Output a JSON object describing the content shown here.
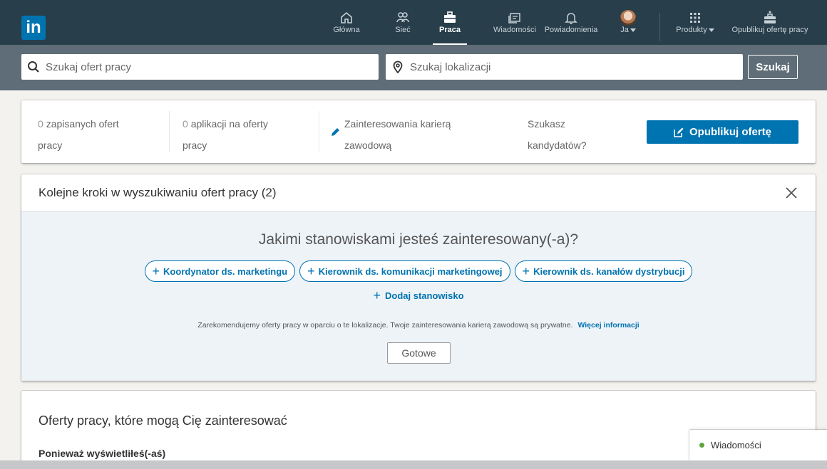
{
  "colors": {
    "nav_bg": "#283e4a",
    "search_band": "#5e6d77",
    "brand_blue": "#0073b1",
    "online_green": "#5fa53d"
  },
  "nav": {
    "logo": "in",
    "items": [
      {
        "label": "Główna",
        "icon": "home-icon"
      },
      {
        "label": "Sieć",
        "icon": "network-icon"
      },
      {
        "label": "Praca",
        "icon": "briefcase-icon",
        "active": true
      },
      {
        "label": "Wiadomości",
        "icon": "messaging-icon"
      },
      {
        "label": "Powiadomienia",
        "icon": "bell-icon"
      },
      {
        "label": "Ja",
        "icon": "avatar"
      },
      {
        "label": "Produkty",
        "icon": "grid-icon"
      },
      {
        "label": "Opublikuj ofertę pracy",
        "icon": "post-job-icon"
      }
    ]
  },
  "search": {
    "jobs_placeholder": "Szukaj ofert pracy",
    "location_placeholder": "Szukaj lokalizacji",
    "button": "Szukaj"
  },
  "stats": {
    "saved_count": "0",
    "saved_label_1": "zapisanych ofert",
    "saved_label_2": "pracy",
    "applications_count": "0",
    "applications_label_1": "aplikacji na oferty",
    "applications_label_2": "pracy",
    "interests_1": "Zainteresowania karierą",
    "interests_2": "zawodową",
    "candidates_1": "Szukasz",
    "candidates_2": "kandydatów?",
    "post_button": "Opublikuj ofertę"
  },
  "next_steps": {
    "title": "Kolejne kroki w wyszukiwaniu ofert pracy (2)",
    "question": "Jakimi stanowiskami jesteś zainteresowany(-a)?",
    "chips": [
      "Koordynator ds. marketingu",
      "Kierownik ds. komunikacji marketingowej",
      "Kierownik ds. kanałów dystrybucji"
    ],
    "add_label": "Dodaj stanowisko",
    "note": "Zarekomendujemy oferty pracy w oparciu o te lokalizacje. Twoje zainteresowania karierą zawodową są prywatne.",
    "note_link": "Więcej informacji",
    "done_button": "Gotowe"
  },
  "offers": {
    "title": "Oferty pracy, które mogą Cię zainteresować",
    "subtitle": "Ponieważ wyświetliłeś(-aś)"
  },
  "messaging": {
    "label": "Wiadomości"
  }
}
